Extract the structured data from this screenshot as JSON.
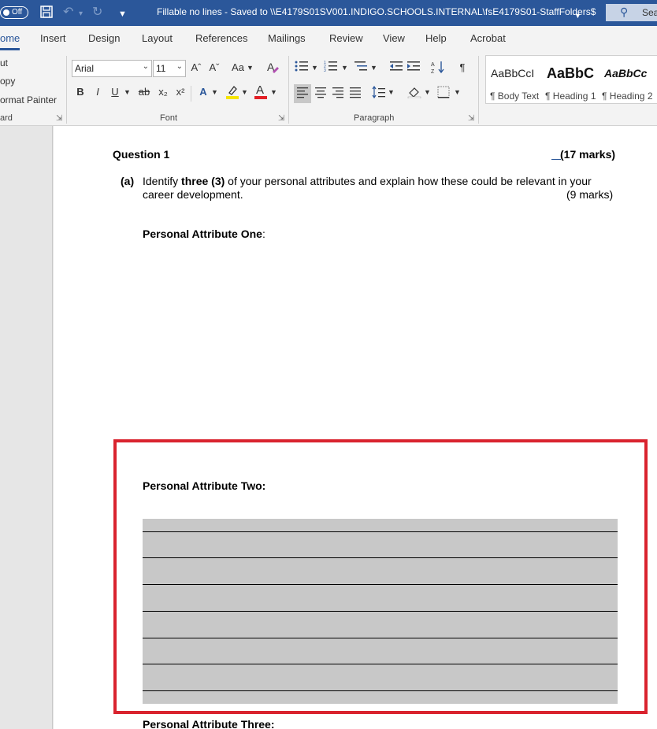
{
  "titlebar": {
    "autosave_label": "Off",
    "document_title": "Fillable no lines  -  Saved to \\\\E4179S01SV001.INDIGO.SCHOOLS.INTERNAL\\fsE4179S01-StaffFolders$",
    "search_placeholder": "Sea"
  },
  "ribbon_tabs": [
    "ome",
    "Insert",
    "Design",
    "Layout",
    "References",
    "Mailings",
    "Review",
    "View",
    "Help",
    "Acrobat"
  ],
  "clipboard": {
    "items": [
      "ut",
      "opy",
      "ormat Painter"
    ],
    "group_label": "ard"
  },
  "font_group": {
    "font_name": "Arial",
    "font_size": "11",
    "grow_label": "Aˆ",
    "shrink_label": "Aˇ",
    "case_label": "Aa",
    "bold_label": "B",
    "italic_label": "I",
    "underline_label": "U",
    "strike_label": "ab",
    "subscript_label": "x₂",
    "superscript_label": "x²",
    "group_label": "Font",
    "highlight_color": "#f5e400",
    "font_color": "#e21f26"
  },
  "paragraph_group": {
    "group_label": "Paragraph",
    "pilcrow": "¶"
  },
  "styles_group": {
    "styles": [
      {
        "preview": "AaBbCcI",
        "name": "¶ Body Text"
      },
      {
        "preview": "AaBbC",
        "name": "¶ Heading 1"
      },
      {
        "preview": "AaBbCc",
        "name": "¶ Heading 2"
      }
    ]
  },
  "document": {
    "question_title": "Question 1",
    "question_marks": "(17 marks)",
    "part_label": "(a)",
    "part_text_before": "Identify ",
    "part_text_bold": "three (3)",
    "part_text_after": " of your personal attributes and explain how these could be relevant in your",
    "part_text_line2": "career development.",
    "part_marks": "(9 marks)",
    "attribute_one_label": "Personal Attribute One",
    "attribute_one_colon": ":",
    "attribute_two_label": "Personal Attribute Two:",
    "attribute_three_label": "Personal Attribute Three:",
    "fillable_area_color": "#c8c8c8",
    "annotation_color": "#d9232e"
  },
  "colors": {
    "brand": "#2b579a"
  }
}
